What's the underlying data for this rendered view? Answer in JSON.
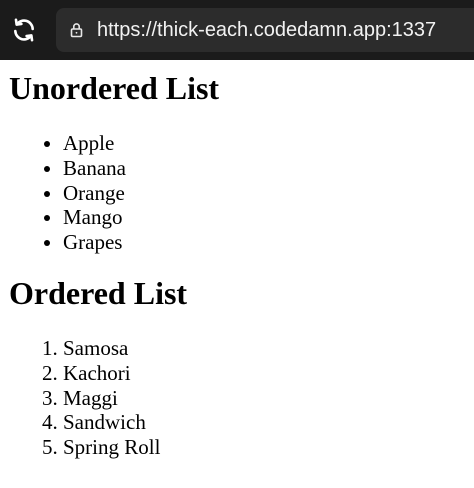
{
  "browser": {
    "url": "https://thick-each.codedamn.app:1337",
    "reload_icon": "reload-icon",
    "lock_icon": "lock-icon"
  },
  "page": {
    "unordered_heading": "Unordered List",
    "unordered_items": [
      "Apple",
      "Banana",
      "Orange",
      "Mango",
      "Grapes"
    ],
    "ordered_heading": "Ordered List",
    "ordered_items": [
      "Samosa",
      "Kachori",
      "Maggi",
      "Sandwich",
      "Spring Roll"
    ]
  },
  "colors": {
    "topbar_bg": "#1b1b1b",
    "urlbar_bg": "#2c2c2c",
    "url_text": "#f2f2f2"
  }
}
